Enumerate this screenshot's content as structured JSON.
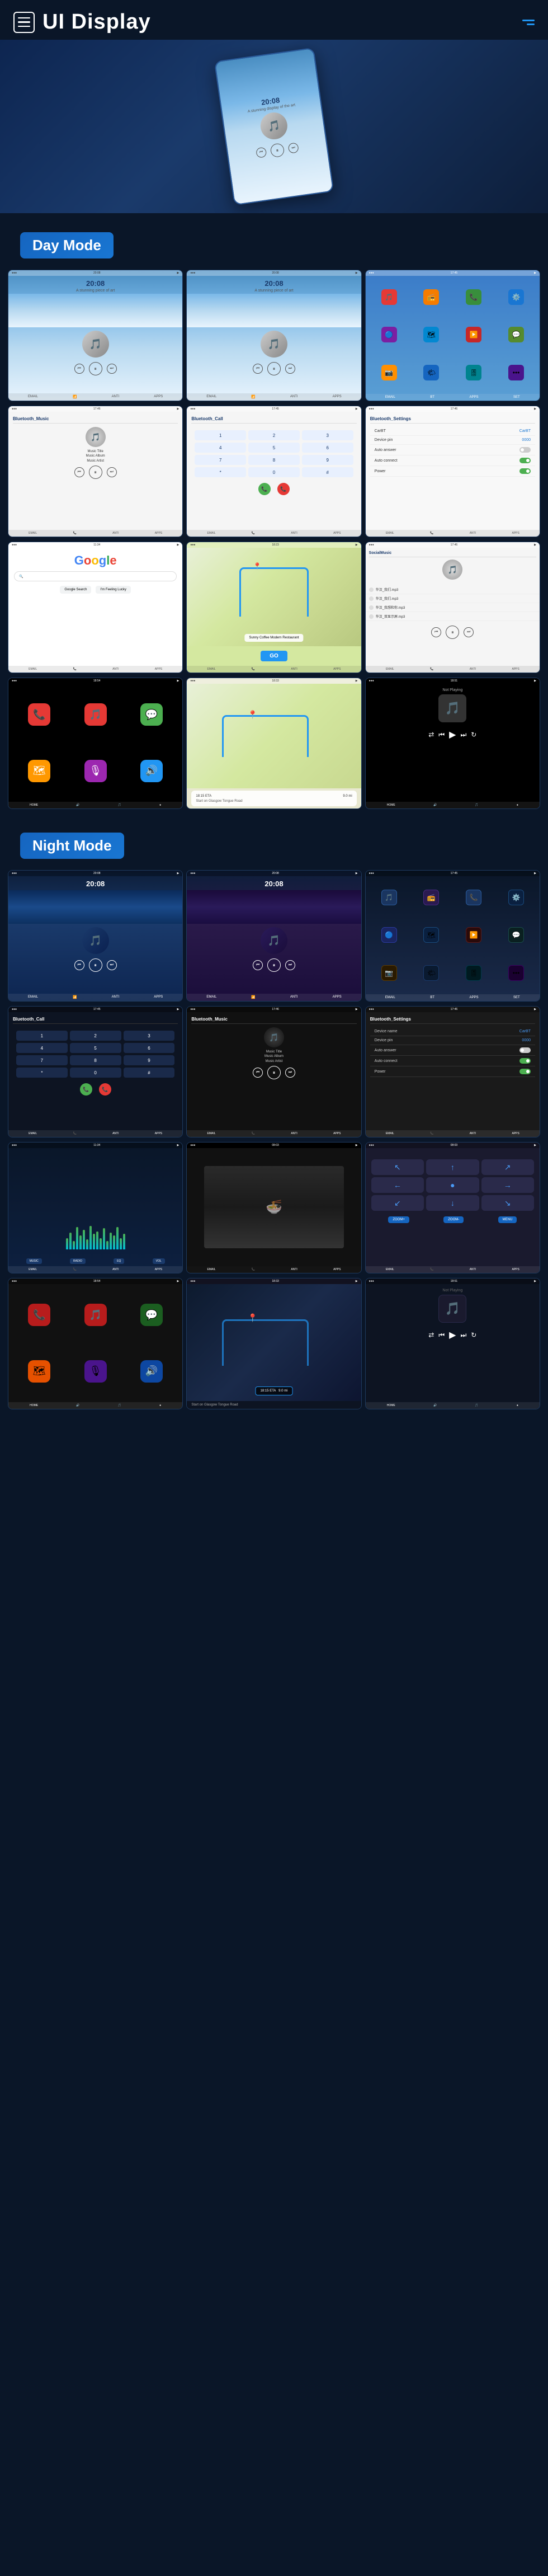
{
  "header": {
    "title": "UI Display",
    "hamburger_label": "Menu",
    "menu_dots": "More options"
  },
  "hero": {
    "time": "20:08",
    "subtitle": "A stunning display of the art"
  },
  "sections": {
    "day_mode_label": "Day Mode",
    "night_mode_label": "Night Mode"
  },
  "day_screens": [
    {
      "id": "day-music-1",
      "time": "20:08",
      "desc": "A stunning piece of art"
    },
    {
      "id": "day-music-2",
      "time": "20:08",
      "desc": "A stunning piece of art"
    },
    {
      "id": "day-apps",
      "label": "Apps Grid"
    },
    {
      "id": "day-bt-music",
      "title": "Bluetooth_Music",
      "track": "Music Title",
      "album": "Music Album",
      "artist": "Music Artist"
    },
    {
      "id": "day-bt-call",
      "title": "Bluetooth_Call"
    },
    {
      "id": "day-bt-settings",
      "title": "Bluetooth_Settings",
      "device_name": "CarBT",
      "device_pin": "0000"
    },
    {
      "id": "day-google",
      "label": "Google"
    },
    {
      "id": "day-map",
      "label": "Navigation Map"
    },
    {
      "id": "day-local",
      "label": "Local Music"
    }
  ],
  "carplay_screens": [
    {
      "id": "carplay-1",
      "label": "CarPlay/Android Auto"
    },
    {
      "id": "carplay-2",
      "label": "Maps CarPlay"
    },
    {
      "id": "carplay-3",
      "label": "Now Playing"
    }
  ],
  "night_screens": [
    {
      "id": "night-music-1",
      "time": "20:08",
      "desc": "A stunning piece of art"
    },
    {
      "id": "night-music-2",
      "time": "20:08",
      "desc": "A stunning piece of art"
    },
    {
      "id": "night-apps",
      "label": "Night Apps"
    },
    {
      "id": "night-call",
      "title": "Bluetooth_Call"
    },
    {
      "id": "night-bt-music",
      "title": "Bluetooth_Music",
      "track": "Music Title",
      "album": "Music Album",
      "artist": "Music Artist"
    },
    {
      "id": "night-settings",
      "title": "Bluetooth_Settings"
    },
    {
      "id": "night-wave",
      "label": "Wave Visualizer"
    },
    {
      "id": "night-video",
      "label": "Video Player"
    },
    {
      "id": "night-map2",
      "label": "Night Map"
    }
  ],
  "night_carplay": [
    {
      "id": "night-carplay-1",
      "label": "Night CarPlay"
    },
    {
      "id": "night-carplay-2",
      "label": "Night Maps"
    },
    {
      "id": "night-carplay-3",
      "label": "Night Now Playing"
    }
  ],
  "app_icons": {
    "phone": "📞",
    "music": "🎵",
    "maps": "🗺",
    "messages": "💬",
    "settings": "⚙️",
    "bluetooth": "📶",
    "radio": "📻",
    "camera": "📷",
    "weather": "🌤",
    "calendar": "📅",
    "clock": "🕐",
    "photos": "🖼"
  },
  "colors": {
    "accent_blue": "#1976d2",
    "bg_dark": "#0a1628",
    "day_bg": "#4a8ec2",
    "night_bg": "#0d1e3a",
    "success_green": "#4caf50",
    "call_green": "#4caf50",
    "call_red": "#e53935"
  },
  "info_panel": {
    "restaurant": "Sunny Coffee Modern Restaurant",
    "eta": "18:15 ETA",
    "distance": "9.0 mi",
    "go_label": "GO",
    "start": "Start on Glasgow Tongue Road"
  },
  "wave_heights": [
    15,
    25,
    35,
    20,
    40,
    30,
    18,
    38,
    28,
    22,
    35,
    15,
    42,
    30,
    20,
    35,
    25,
    18
  ],
  "night_wave_heights": [
    20,
    30,
    15,
    40,
    25,
    35,
    18,
    42,
    28,
    32,
    20,
    38,
    15,
    30,
    25,
    40,
    20,
    28
  ]
}
